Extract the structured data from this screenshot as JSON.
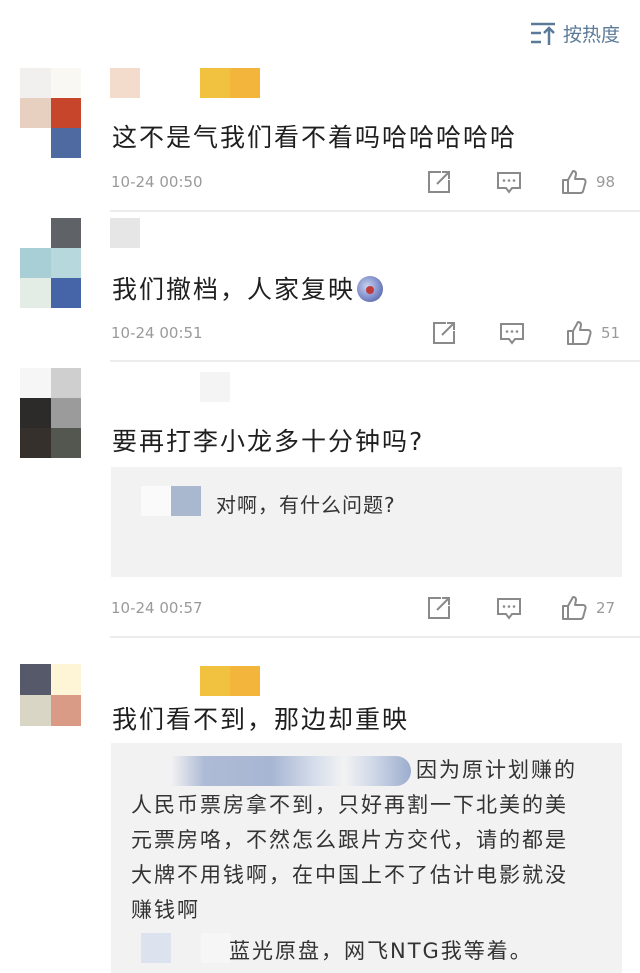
{
  "sort": {
    "label": "按热度"
  },
  "comments": [
    {
      "text": "这不是气我们看不着吗哈哈哈哈哈",
      "time": "10-24 00:50",
      "likes": "98"
    },
    {
      "text": "我们撤档，人家复映",
      "time": "10-24 00:51",
      "likes": "51"
    },
    {
      "text": "要再打李小龙多十分钟吗?",
      "time": "10-24 00:57",
      "likes": "27",
      "replies": [
        {
          "text": "对啊，有什么问题?"
        }
      ]
    },
    {
      "text": "我们看不到，那边却重映",
      "replies": [
        {
          "lines": [
            "因为原计划赚的",
            "人民币票房拿不到，只好再割一下北美的美",
            "元票房咯，不然怎么跟片方交代，请的都是",
            "大牌不用钱啊，在中国上不了估计电影就没",
            "赚钱啊"
          ]
        },
        {
          "text": "蓝光原盘，网飞NTG我等着。"
        }
      ]
    }
  ],
  "icons": {
    "share": "share-icon",
    "reply": "comment-icon",
    "like": "thumbs-up-icon",
    "sort": "sort-icon"
  },
  "colors": {
    "accent": "#5b7a99",
    "meta": "#9a9a9a",
    "badge": "#f0c23f",
    "reply_bg": "#f2f2f2"
  }
}
